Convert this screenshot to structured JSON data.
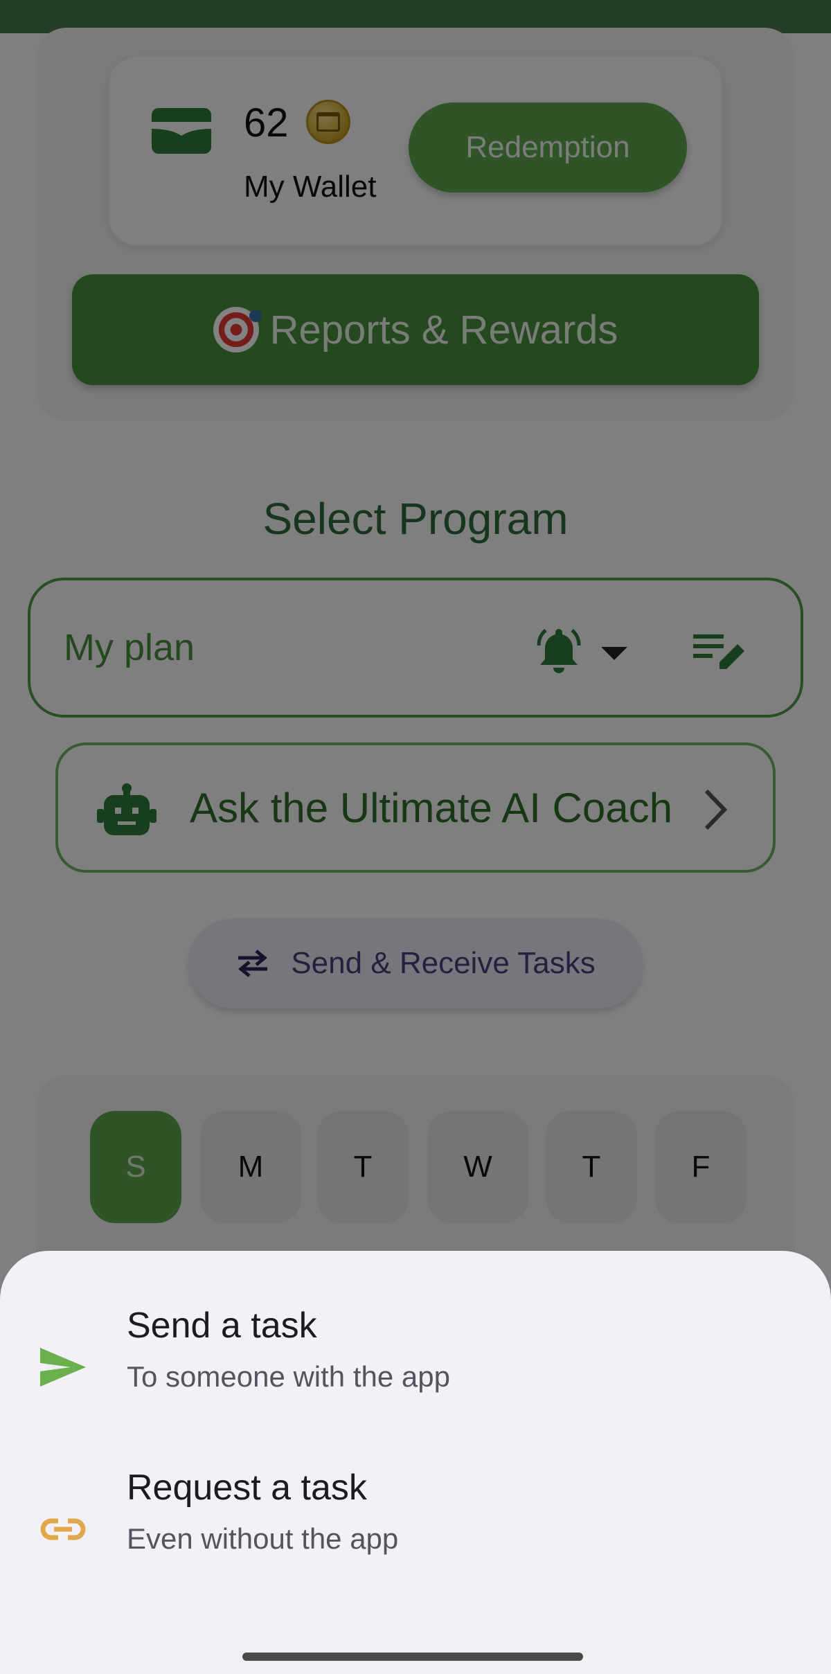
{
  "wallet": {
    "amount": "62",
    "label": "My Wallet",
    "redemption_label": "Redemption"
  },
  "reports": {
    "label": "Reports & Rewards"
  },
  "program": {
    "title": "Select Program",
    "selected_plan": "My plan"
  },
  "coach": {
    "label": "Ask the Ultimate AI Coach"
  },
  "tasks": {
    "send_receive_label": "Send & Receive Tasks"
  },
  "days": [
    "S",
    "M",
    "T",
    "W",
    "T",
    "F"
  ],
  "selected_day_index": 0,
  "sheet": {
    "options": [
      {
        "title": "Send a task",
        "subtitle": "To someone with the app",
        "icon": "send-icon"
      },
      {
        "title": "Request a task",
        "subtitle": "Even without the app",
        "icon": "link-icon"
      }
    ]
  },
  "colors": {
    "primary_green": "#5aa650",
    "dark_green": "#2e6a3a",
    "link_orange": "#e0a84a",
    "sheet_bg": "#f2f1f7"
  }
}
